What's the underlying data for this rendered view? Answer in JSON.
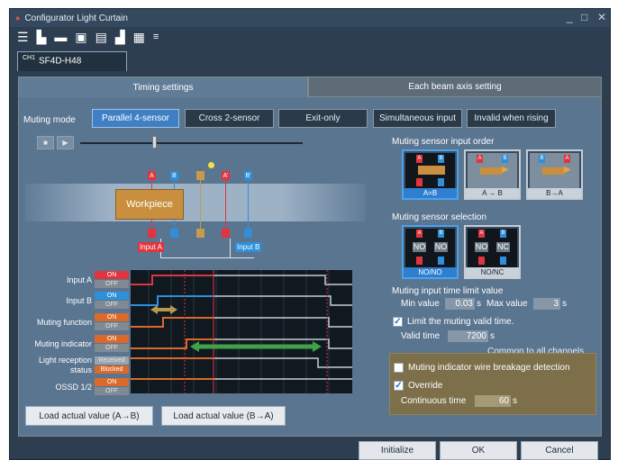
{
  "window": {
    "title": "Configurator Light Curtain",
    "controls": {
      "minimize": "_",
      "maximize": "□",
      "close": "✕"
    }
  },
  "toolbar": {
    "icons": [
      "menu-icon",
      "new-file-icon",
      "open-folder-icon",
      "save-icon",
      "save-as-icon",
      "export-icon",
      "print-icon",
      "dropdown-icon"
    ]
  },
  "channel": {
    "prefix": "CH1",
    "model": "SF4D-H48"
  },
  "tabs": [
    {
      "label": "Timing settings",
      "active": true
    },
    {
      "label": "Each beam axis setting",
      "active": false
    }
  ],
  "muting": {
    "mode_label": "Muting mode",
    "modes": [
      "Parallel 4-sensor",
      "Cross 2-sensor",
      "Exit-only",
      "Simultaneous input",
      "Invalid when rising"
    ],
    "selected_mode": "Parallel 4-sensor"
  },
  "diagram": {
    "workpiece": "Workpiece",
    "sensor_labels": {
      "a": "A",
      "b": "B",
      "a_prime": "A'",
      "b_prime": "B'"
    },
    "input_a": "Input A",
    "input_b": "Input B"
  },
  "timing_chart": {
    "rows": [
      {
        "label": "Input A",
        "on": "ON",
        "off": "OFF"
      },
      {
        "label": "Input B",
        "on": "ON",
        "off": "OFF"
      },
      {
        "label": "Muting function",
        "on": "ON",
        "off": "OFF"
      },
      {
        "label": "Muting indicator",
        "on": "ON",
        "off": "OFF"
      },
      {
        "label": "Light reception status",
        "on": "Received",
        "off": "Blocked"
      },
      {
        "label": "OSSD 1/2",
        "on": "ON",
        "off": "OFF"
      }
    ]
  },
  "load_buttons": {
    "a_to_b": "Load actual value (A→B)",
    "b_to_a": "Load actual value (B→A)"
  },
  "sensor_order": {
    "title": "Muting sensor input order",
    "options": [
      "A=B",
      "A → B",
      "B→A"
    ],
    "selected": "A=B"
  },
  "sensor_selection": {
    "title": "Muting sensor selection",
    "options": [
      "NO/NO",
      "NO/NC"
    ],
    "selected": "NO/NO",
    "no_label": "NO",
    "nc_label": "NC"
  },
  "time_limit": {
    "title": "Muting input time limit value",
    "min_label": "Min value",
    "min_value": "0.03",
    "min_unit": "s",
    "max_label": "Max value",
    "max_value": "3",
    "max_unit": "s",
    "limit_checkbox_label": "Limit the muting valid time.",
    "limit_checked": true,
    "valid_time_label": "Valid time",
    "valid_time_value": "7200",
    "valid_time_unit": "s"
  },
  "common": {
    "title": "Common to all channels",
    "wire_breakage_label": "Muting indicator wire breakage detection",
    "wire_breakage_checked": false,
    "override_label": "Override",
    "override_checked": true,
    "continuous_label": "Continuous time",
    "continuous_value": "60",
    "continuous_unit": "s"
  },
  "footer": {
    "initialize": "Initialize",
    "ok": "OK",
    "cancel": "Cancel"
  }
}
